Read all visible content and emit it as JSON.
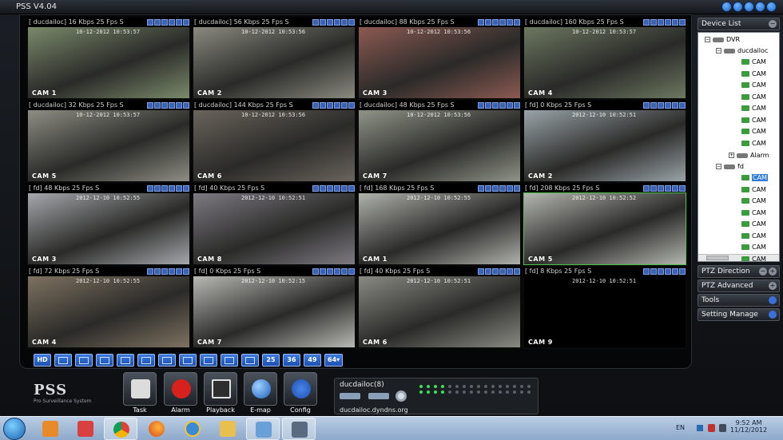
{
  "app": {
    "title": "PSS  V4.04"
  },
  "cells": [
    {
      "label": "[ ducdailoc] 16 Kbps 25 Fps S",
      "cam": "CAM 1",
      "ts": "10-12-2012 10:53:57",
      "bg": "#7a8a6a"
    },
    {
      "label": "[ ducdailoc] 56 Kbps 25 Fps S",
      "cam": "CAM 2",
      "ts": "10-12-2012 10:53:56",
      "bg": "#8a8a80"
    },
    {
      "label": "[ ducdailoc] 88 Kbps 25 Fps S",
      "cam": "CAM 3",
      "ts": "10-12-2012 10:53:56",
      "bg": "#8c5a52"
    },
    {
      "label": "[ ducdailoc] 160 Kbps 25 Fps S",
      "cam": "CAM 4",
      "ts": "10-12-2012 10:53:57",
      "bg": "#6c7860"
    },
    {
      "label": "[ ducdailoc] 32 Kbps 25 Fps S",
      "cam": "CAM 5",
      "ts": "10-12-2012 10:53:57",
      "bg": "#8e8e84"
    },
    {
      "label": "[ ducdailoc] 144 Kbps 25 Fps S",
      "cam": "CAM 6",
      "ts": "10-12-2012 10:53:56",
      "bg": "#6a645c"
    },
    {
      "label": "[ ducdailoc] 48 Kbps 25 Fps S",
      "cam": "CAM 7",
      "ts": "10-12-2012 10:53:56",
      "bg": "#909488"
    },
    {
      "label": "[ fd] 0 Kbps 25 Fps S",
      "cam": "CAM 2",
      "ts": "2012-12-10 10:52:51",
      "bg": "#9aa4a8"
    },
    {
      "label": "[ fd] 48 Kbps 25 Fps S",
      "cam": "CAM 3",
      "ts": "2012-12-10 10:52:55",
      "bg": "#a6a8ac"
    },
    {
      "label": "[ fd] 40 Kbps 25 Fps S",
      "cam": "CAM 8",
      "ts": "2012-12-10 10:52:51",
      "bg": "#7e7a82"
    },
    {
      "label": "[ fd] 168 Kbps 25 Fps S",
      "cam": "CAM 1",
      "ts": "2012-12-10 10:52:55",
      "bg": "#b0b2ac"
    },
    {
      "label": "[ fd] 208 Kbps 25 Fps S",
      "cam": "CAM 5",
      "ts": "2012-12-10 10:52:52",
      "bg": "#b4b6b0"
    },
    {
      "label": "[ fd] 72 Kbps 25 Fps S",
      "cam": "CAM 4",
      "ts": "2012-12-10 10:52:55",
      "bg": "#7e7260"
    },
    {
      "label": "[ fd] 0 Kbps 25 Fps S",
      "cam": "CAM 7",
      "ts": "2012-12-10 10:52:15",
      "bg": "#b8b8b4"
    },
    {
      "label": "[ fd] 40 Kbps 25 Fps S",
      "cam": "CAM 6",
      "ts": "2012-12-10 10:52:51",
      "bg": "#8a8a84"
    },
    {
      "label": "[ fd] 8 Kbps 25 Fps S",
      "cam": "CAM 9",
      "ts": "2012-12-10 10:52:51",
      "bg": "#000000"
    }
  ],
  "toolbar": {
    "hd": "HD",
    "n25": "25",
    "n36": "36",
    "n49": "49",
    "n64": "64▾"
  },
  "panel": {
    "device_list": "Device List",
    "ptz_direction": "PTZ Direction",
    "ptz_advanced": "PTZ Advanced",
    "tools": "Tools",
    "setting_manage": "Setting Manage",
    "plus": "+",
    "minus": "−"
  },
  "tree": {
    "dvr": "DVR",
    "ducdailoc": "ducdailoc",
    "cam": "CAM",
    "alarm": "Alarm",
    "fd": "fd",
    "expanded": "−",
    "collapsed": "+"
  },
  "logo": {
    "big": "PSS",
    "small": "Pro Surveillance System"
  },
  "apps": {
    "task": "Task",
    "alarm": "Alarm",
    "playback": "Playback",
    "emap": "E-map",
    "config": "Config"
  },
  "device": {
    "name": "ducdailoc(8)",
    "host": "ducdailoc.dyndns.org",
    "leds_on": 8,
    "leds_total": 32
  },
  "taskbar": {
    "lang": "EN",
    "time": "9:52 AM",
    "date": "11/12/2012"
  }
}
